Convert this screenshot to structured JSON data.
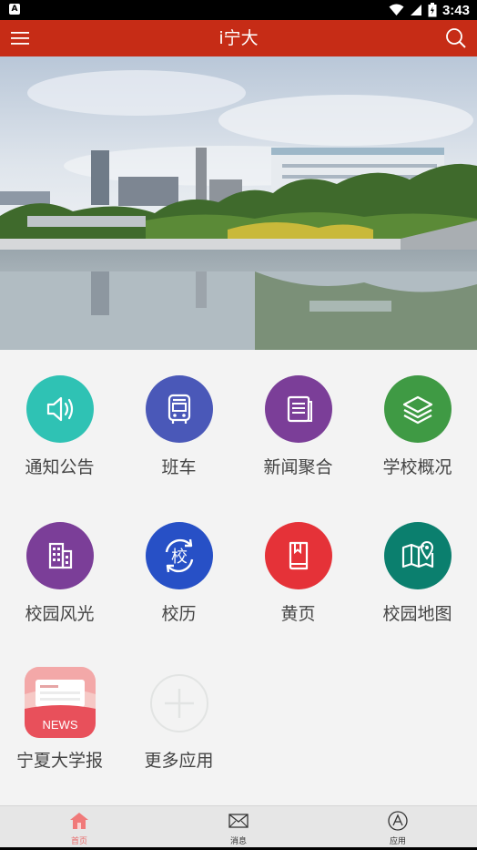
{
  "status_bar": {
    "time": "3:43",
    "icons": [
      "app-notification-icon",
      "wifi-icon",
      "signal-icon",
      "battery-icon"
    ]
  },
  "app_bar": {
    "title": "i宁大",
    "left_icon": "menu-icon",
    "right_icon": "search-icon",
    "color": "#c62c16"
  },
  "apps": [
    {
      "label": "通知公告",
      "icon": "speaker-icon",
      "color": "#2fc2b4"
    },
    {
      "label": "班车",
      "icon": "bus-icon",
      "color": "#4a58b8"
    },
    {
      "label": "新闻聚合",
      "icon": "news-icon",
      "color": "#7b3e98"
    },
    {
      "label": "学校概况",
      "icon": "layers-icon",
      "color": "#3f9a44"
    },
    {
      "label": "校园风光",
      "icon": "building-icon",
      "color": "#7b3e98"
    },
    {
      "label": "校历",
      "icon": "calendar-school-icon",
      "color": "#2750c6",
      "glyph": "校"
    },
    {
      "label": "黄页",
      "icon": "book-icon",
      "color": "#e53238"
    },
    {
      "label": "校园地图",
      "icon": "map-icon",
      "color": "#0b7f6e"
    },
    {
      "label": "宁夏大学报",
      "icon": "newspaper-app-icon",
      "badge": "NEWS",
      "color": "#e8505b"
    },
    {
      "label": "更多应用",
      "icon": "plus-icon",
      "color": "#e3e3e3"
    }
  ],
  "tabs": [
    {
      "label": "首页",
      "icon": "home-icon",
      "active": true
    },
    {
      "label": "消息",
      "icon": "mail-icon",
      "active": false
    },
    {
      "label": "应用",
      "icon": "apps-icon",
      "active": false
    }
  ],
  "colors": {
    "accent": "#c62c16",
    "active_tab": "#e86a6a",
    "background": "#f3f3f3"
  }
}
